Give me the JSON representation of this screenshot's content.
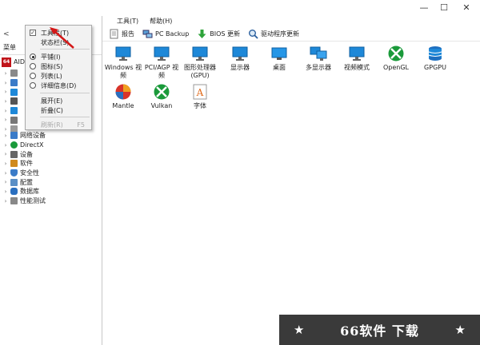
{
  "window": {
    "minimize": "—",
    "maximize": "☐",
    "close": "✕"
  },
  "menubar": {
    "tools": "工具(T)",
    "help": "帮助(H)"
  },
  "toolbar": {
    "report": "报告",
    "pc_backup": "PC Backup",
    "bios_update": "BIOS 更新",
    "driver_update": "驱动程序更新"
  },
  "leftpane": {
    "menu_label": "菜单",
    "app_badge": "64",
    "app_name": "AIDA",
    "tree": [
      {
        "label": "网络设备",
        "icon": "network-icon"
      },
      {
        "label": "DirectX",
        "icon": "directx-icon"
      },
      {
        "label": "设备",
        "icon": "device-icon"
      },
      {
        "label": "软件",
        "icon": "software-icon"
      },
      {
        "label": "安全性",
        "icon": "security-icon"
      },
      {
        "label": "配置",
        "icon": "config-icon"
      },
      {
        "label": "数据库",
        "icon": "database-icon"
      },
      {
        "label": "性能测试",
        "icon": "benchmark-icon"
      }
    ]
  },
  "dropdown": {
    "toolbar": "工具栏(T)",
    "statusbar": "状态栏(S)",
    "tile": "平铺(I)",
    "icons": "图标(S)",
    "list": "列表(L)",
    "details": "详细信息(D)",
    "expand": "展开(E)",
    "collapse": "折叠(C)",
    "refresh": "刷新(R)",
    "refresh_key": "F5"
  },
  "content": {
    "items": [
      {
        "label": "Windows 视频",
        "icon": "monitor-icon"
      },
      {
        "label": "PCI/AGP 视频",
        "icon": "monitor-icon"
      },
      {
        "label": "图形处理器 (GPU)",
        "icon": "monitor-icon"
      },
      {
        "label": "显示器",
        "icon": "display-icon"
      },
      {
        "label": "桌面",
        "icon": "desktop-icon"
      },
      {
        "label": "多显示器",
        "icon": "multi-monitor-icon"
      },
      {
        "label": "视频模式",
        "icon": "video-mode-icon"
      },
      {
        "label": "OpenGL",
        "icon": "xbox-icon"
      },
      {
        "label": "GPGPU",
        "icon": "gpgpu-icon"
      },
      {
        "label": "Mantle",
        "icon": "mantle-icon"
      },
      {
        "label": "Vulkan",
        "icon": "xbox-icon"
      },
      {
        "label": "字体",
        "icon": "font-icon"
      }
    ]
  },
  "watermark": {
    "text": "66软件 下载",
    "star": "★"
  },
  "colors": {
    "accent_blue": "#1e88d8",
    "xbox_green": "#1a9a3a",
    "aida_red": "#c0141a"
  }
}
